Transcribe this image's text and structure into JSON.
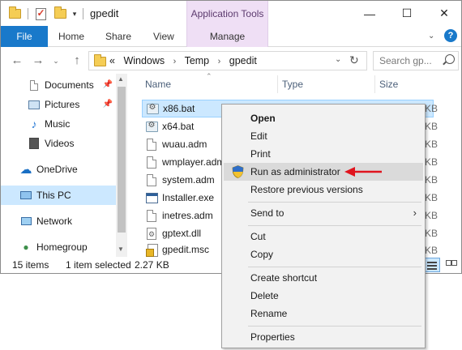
{
  "titlebar": {
    "title": "gpedit",
    "contextual_group": "Application Tools"
  },
  "ribbon": {
    "tabs": [
      "File",
      "Home",
      "Share",
      "View"
    ],
    "contextual_tab": "Manage"
  },
  "address": {
    "overflow": "«",
    "crumbs": [
      "Windows",
      "Temp",
      "gpedit"
    ]
  },
  "search": {
    "placeholder": "Search gp..."
  },
  "navpane": {
    "items": [
      {
        "label": "Documents",
        "icon": "documents-icon",
        "pinned": true
      },
      {
        "label": "Pictures",
        "icon": "pictures-icon",
        "pinned": true
      },
      {
        "label": "Music",
        "icon": "music-icon",
        "pinned": false
      },
      {
        "label": "Videos",
        "icon": "videos-icon",
        "pinned": false
      },
      {
        "label": "OneDrive",
        "icon": "onedrive-icon",
        "pinned": false
      },
      {
        "label": "This PC",
        "icon": "this-pc-icon",
        "pinned": false,
        "selected": true
      },
      {
        "label": "Network",
        "icon": "network-icon",
        "pinned": false
      },
      {
        "label": "Homegroup",
        "icon": "homegroup-icon",
        "pinned": false
      }
    ]
  },
  "columns": {
    "name": "Name",
    "type": "Type",
    "size": "Size"
  },
  "files": [
    {
      "name": "x86.bat",
      "icon": "batch-file-icon",
      "size": "KB",
      "selected": true
    },
    {
      "name": "x64.bat",
      "icon": "batch-file-icon",
      "size": "KB"
    },
    {
      "name": "wuau.adm",
      "icon": "document-icon",
      "size": "KB"
    },
    {
      "name": "wmplayer.adm",
      "icon": "document-icon",
      "size": "KB"
    },
    {
      "name": "system.adm",
      "icon": "document-icon",
      "size": "KB"
    },
    {
      "name": "Installer.exe",
      "icon": "application-icon",
      "size": "KB"
    },
    {
      "name": "inetres.adm",
      "icon": "document-icon",
      "size": "KB"
    },
    {
      "name": "gptext.dll",
      "icon": "dll-icon",
      "size": "KB"
    },
    {
      "name": "gpedit.msc",
      "icon": "console-icon",
      "size": "KB"
    }
  ],
  "status": {
    "count": "15 items",
    "selected": "1 item selected",
    "size": "2.27 KB"
  },
  "context_menu": {
    "open": "Open",
    "edit": "Edit",
    "print": "Print",
    "run_as_admin": "Run as administrator",
    "restore": "Restore previous versions",
    "send_to": "Send to",
    "cut": "Cut",
    "copy": "Copy",
    "create_shortcut": "Create shortcut",
    "delete": "Delete",
    "rename": "Rename",
    "properties": "Properties"
  },
  "colors": {
    "accent": "#1979ca",
    "selection": "#cce8ff",
    "contextual_tab": "#efdff5",
    "annotation_arrow": "#e0141e"
  }
}
